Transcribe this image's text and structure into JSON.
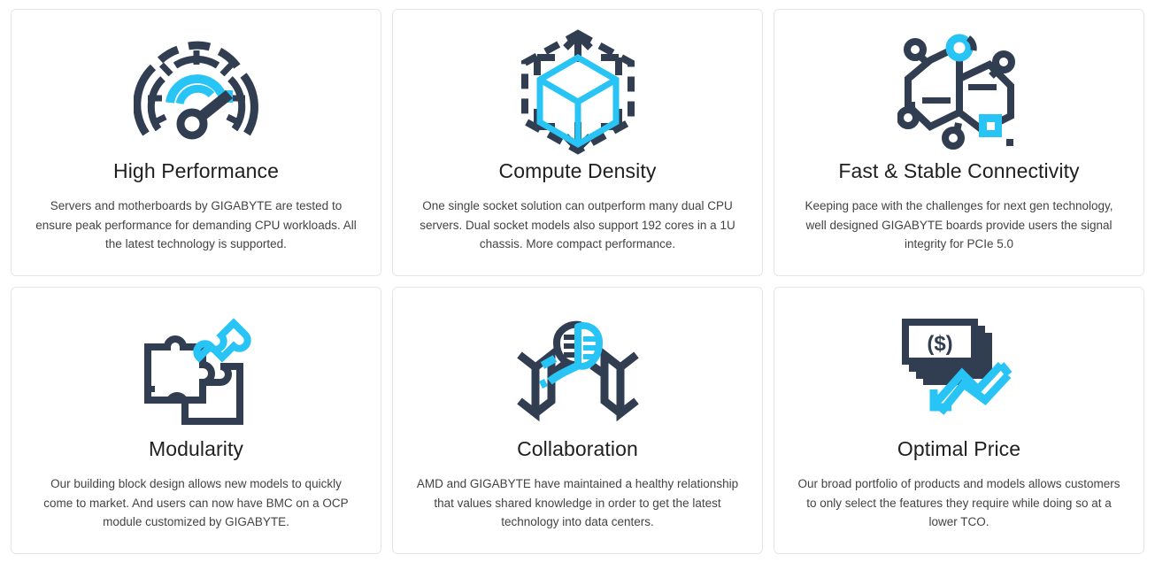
{
  "theme": {
    "page_background": "#ffffff",
    "card_background": "#ffffff",
    "card_border": "#e6e6e6",
    "title_color": "#21201f",
    "body_color": "#434343",
    "icon_dark": "#313d50",
    "icon_accent": "#27c4f5"
  },
  "grid": {
    "columns": 3,
    "rows": 2,
    "cards": [
      {
        "icon": "speedometer-icon",
        "title": "High Performance",
        "description": "Servers and motherboards by GIGABYTE are tested to ensure peak performance for demanding CPU workloads. All the latest technology is supported."
      },
      {
        "icon": "hexagon-cube-icon",
        "title": "Compute Density",
        "description": "One single socket solution can outperform many dual CPU servers. Dual socket models also support 192 cores in a 1U chassis. More compact performance."
      },
      {
        "icon": "molecule-network-icon",
        "title": "Fast & Stable Connectivity",
        "description": "Keeping pace with the challenges for next gen technology, well designed GIGABYTE boards provide users the signal integrity for PCIe 5.0"
      },
      {
        "icon": "puzzle-pieces-icon",
        "title": "Modularity",
        "description": "Our building block design allows new models to quickly come to market. And users can now have BMC on a OCP module customized by GIGABYTE."
      },
      {
        "icon": "handshake-icon",
        "title": "Collaboration",
        "description": "AMD and GIGABYTE have maintained a healthy relationship that values shared knowledge in order to get the latest technology into data centers."
      },
      {
        "icon": "money-down-arrow-icon",
        "title": "Optimal Price",
        "description": "Our broad portfolio of products and models allows customers to only select the features they require while doing so at a lower TCO."
      }
    ]
  }
}
